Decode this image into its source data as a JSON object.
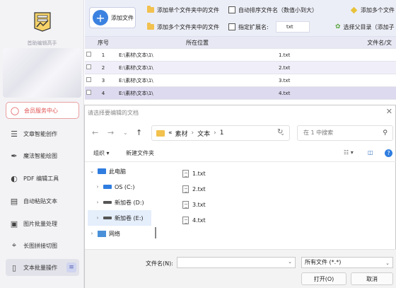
{
  "sidebar": {
    "title": "首助编辑高手",
    "items": [
      {
        "label": "会员服务中心",
        "icon": "user-icon"
      },
      {
        "label": "文章智能创作",
        "icon": "list-icon"
      },
      {
        "label": "魔法智能绘图",
        "icon": "brush-icon"
      },
      {
        "label": "PDF 编辑工具",
        "icon": "pdf-icon"
      },
      {
        "label": "自动粘贴文本",
        "icon": "paste-icon"
      },
      {
        "label": "图片批量处理",
        "icon": "image-icon"
      },
      {
        "label": "长图拼接切图",
        "icon": "crop-icon"
      },
      {
        "label": "文本批量操作",
        "icon": "text-icon"
      }
    ]
  },
  "toolbar": {
    "add_file": "添加文件",
    "add_single_folder": "添加单个文件夹中的文件",
    "add_multi_folder": "添加多个文件夹中的文件",
    "auto_sort": "自动排序文件名（数值小到大）",
    "specify_ext": "指定扩展名:",
    "ext_value": "txt",
    "add_many_files": "添加多个文件",
    "choose_parent": "选择父目录（添加子"
  },
  "table": {
    "headers": [
      "序号",
      "所在位置",
      "文件名/文"
    ],
    "rows": [
      {
        "no": "1",
        "path": "E:\\素材\\文本\\1\\",
        "name": "1.txt"
      },
      {
        "no": "2",
        "path": "E:\\素材\\文本\\1\\",
        "name": "2.txt"
      },
      {
        "no": "3",
        "path": "E:\\素材\\文本\\1\\",
        "name": "3.txt"
      },
      {
        "no": "4",
        "path": "E:\\素材\\文本\\1\\",
        "name": "4.txt"
      }
    ]
  },
  "dialog": {
    "title": "请选择要编辑的文档",
    "breadcrumb": [
      "«",
      "素材",
      "文本",
      "1"
    ],
    "search_placeholder": "在 1 中搜索",
    "organize": "组织 ▾",
    "new_folder": "新建文件夹",
    "tree": [
      {
        "label": "此电脑",
        "expanded": true
      },
      {
        "label": "OS (C:)"
      },
      {
        "label": "新加卷 (D:)"
      },
      {
        "label": "新加卷 (E:)",
        "selected": true
      },
      {
        "label": "网络"
      }
    ],
    "files": [
      "1.txt",
      "2.txt",
      "3.txt",
      "4.txt"
    ],
    "filename_label": "文件名(N):",
    "filename_value": "",
    "filetype": "所有文件 (*.*)",
    "open": "打开(O)",
    "cancel": "取消"
  },
  "colors": {
    "accent": "#3b82e0",
    "member": "#e05050",
    "folder": "#f2c14e"
  }
}
